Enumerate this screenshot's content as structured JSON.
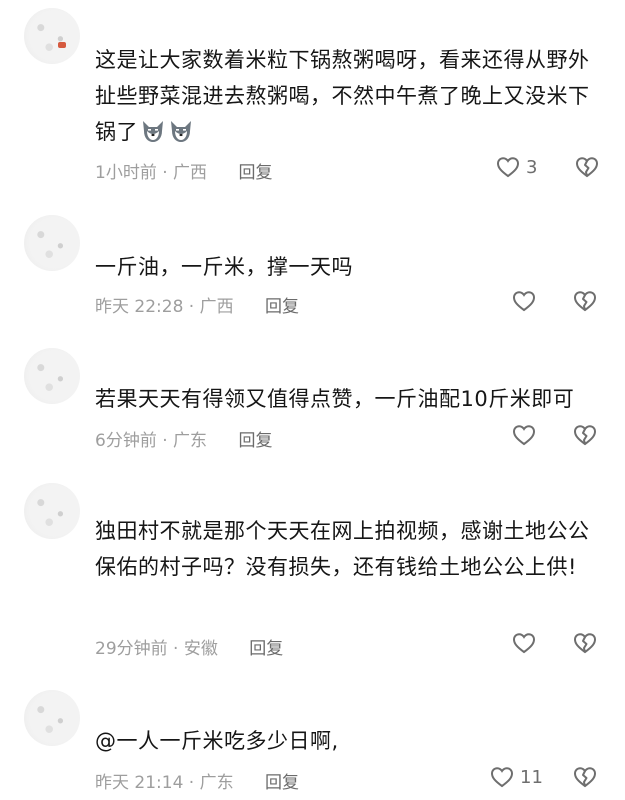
{
  "comments": [
    {
      "text": "这是让大家数着米粒下锅熬粥喝呀，看来还得从野外扯些野菜混进去熬粥喝，不然中午煮了晚上又没米下锅了",
      "emoji": "wolf-face-icon",
      "time": "1小时前",
      "location": "广西",
      "reply": "回复",
      "likes": "3"
    },
    {
      "text": "一斤油，一斤米，撑一天吗",
      "time": "昨天 22:28",
      "location": "广西",
      "reply": "回复",
      "likes": ""
    },
    {
      "text": "若果天天有得领又值得点赞，一斤油配10斤米即可",
      "time": "6分钟前",
      "location": "广东",
      "reply": "回复",
      "likes": ""
    },
    {
      "text": "独田村不就是那个天天在网上拍视频，感谢土地公公保佑的村子吗？没有损失，还有钱给土地公公上供!",
      "time": "29分钟前",
      "location": "安徽",
      "reply": "回复",
      "likes": ""
    },
    {
      "text": "@一人一斤米吃多少日啊,",
      "time": "昨天 21:14",
      "location": "广东",
      "reply": "回复",
      "likes": "11"
    }
  ],
  "icons": {
    "like": "heart-outline-icon",
    "dislike": "broken-heart-icon"
  },
  "colors": {
    "text": "#161616",
    "meta": "#9e9e9e",
    "reply": "#6b6b6b",
    "icon": "#6e6e6e"
  }
}
